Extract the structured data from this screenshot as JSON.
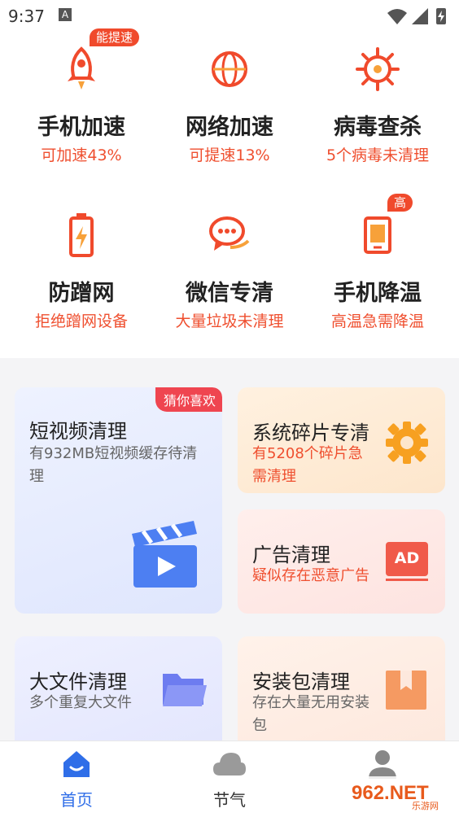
{
  "status": {
    "time": "9:37",
    "a_icon": "A"
  },
  "features": [
    {
      "icon": "rocket-icon",
      "title": "手机加速",
      "sub": "可加速43%",
      "badge": "能提速"
    },
    {
      "icon": "globe-icon",
      "title": "网络加速",
      "sub": "可提速13%",
      "badge": ""
    },
    {
      "icon": "virus-icon",
      "title": "病毒查杀",
      "sub": "5个病毒未清理",
      "badge": ""
    },
    {
      "icon": "battery-icon",
      "title": "防蹭网",
      "sub": "拒绝蹭网设备",
      "badge": ""
    },
    {
      "icon": "chat-bubble-icon",
      "title": "微信专清",
      "sub": "大量垃圾未清理",
      "badge": ""
    },
    {
      "icon": "phone-cool-icon",
      "title": "手机降温",
      "sub": "高温急需降温",
      "badge": "高"
    }
  ],
  "cards": {
    "video": {
      "title": "短视频清理",
      "sub": "有932MB短视频缓存待清理",
      "badge": "猜你喜欢"
    },
    "fragments": {
      "title": "系统碎片专清",
      "sub": "有5208个碎片急需清理"
    },
    "ads": {
      "title": "广告清理",
      "sub": "疑似存在恶意广告",
      "icon_text": "AD"
    },
    "bigfile": {
      "title": "大文件清理",
      "sub": "多个重复大文件"
    },
    "apk": {
      "title": "安装包清理",
      "sub": "存在大量无用安装包"
    }
  },
  "tabs": [
    {
      "label": "首页",
      "icon": "home-icon",
      "active": true
    },
    {
      "label": "节气",
      "icon": "cloud-icon",
      "active": false
    },
    {
      "label": "",
      "icon": "user-icon",
      "active": false
    }
  ],
  "watermark": {
    "text": "962.NET",
    "sub": "乐游网"
  },
  "colors": {
    "accent": "#ef4f2f",
    "tab_active": "#2f6ee8",
    "badge": "#f04a2c"
  }
}
